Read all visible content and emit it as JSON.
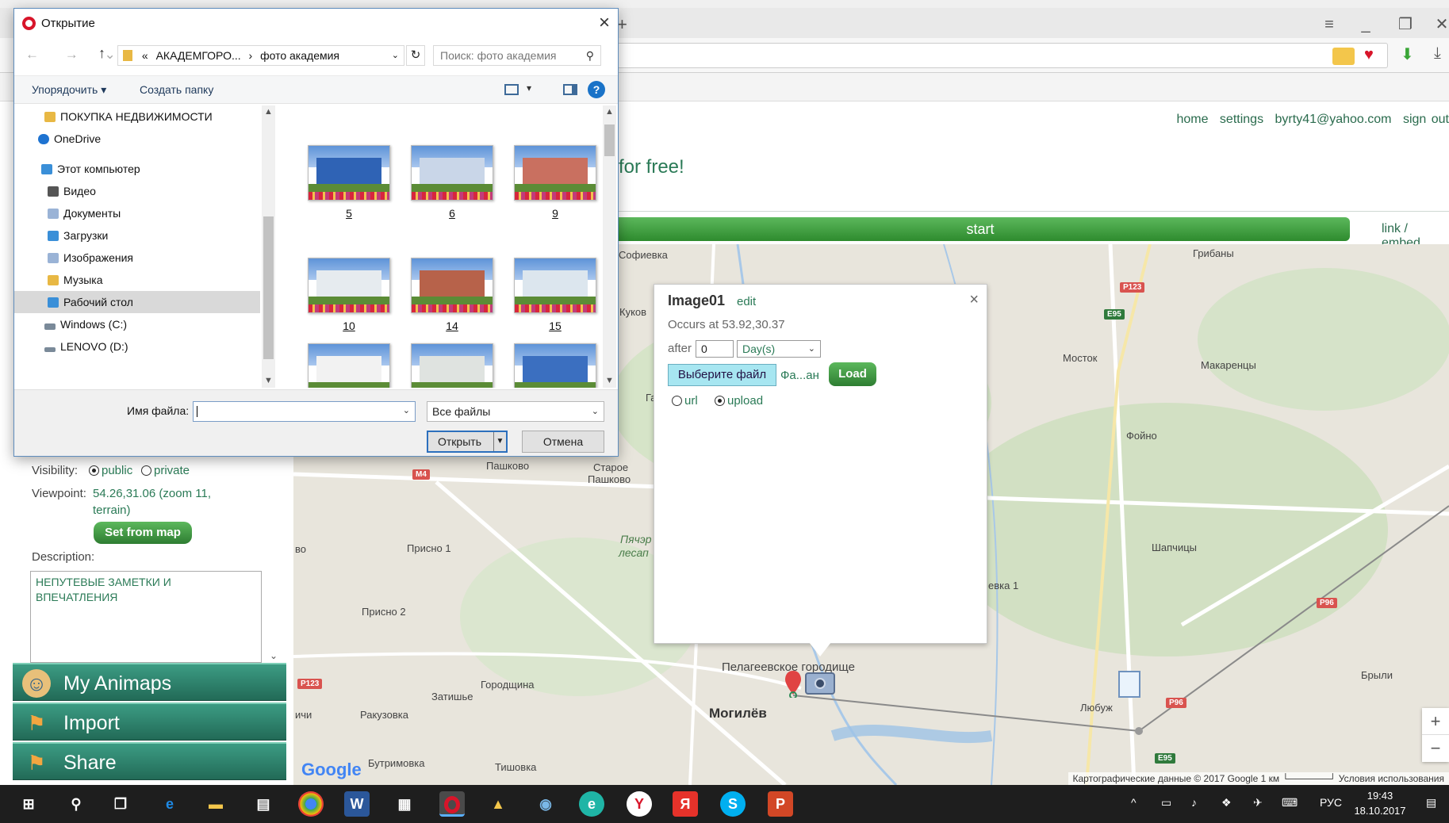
{
  "dialog": {
    "title": "Открытие",
    "path": {
      "prefix": "«",
      "segment1": "АКАДЕМГОРО...",
      "separator": "›",
      "segment2": "фото академия"
    },
    "search_placeholder": "Поиск: фото академия",
    "toolbar": {
      "organize": "Упорядочить ▾",
      "new_folder": "Создать папку",
      "help": "?"
    },
    "tree": [
      {
        "label": "ПОКУПКА НЕДВИЖИМОСТИ",
        "icon": "folder-icon",
        "color": "#e8b844"
      },
      {
        "label": "OneDrive",
        "icon": "onedrive-icon",
        "color": "#1e73d1"
      },
      {
        "label": "Этот компьютер",
        "icon": "computer-icon",
        "color": "#3a8fd8"
      },
      {
        "label": "Видео",
        "icon": "video-folder-icon",
        "color": "#555555"
      },
      {
        "label": "Документы",
        "icon": "documents-folder-icon",
        "color": "#9ab3d6"
      },
      {
        "label": "Загрузки",
        "icon": "downloads-folder-icon",
        "color": "#3a8fd8"
      },
      {
        "label": "Изображения",
        "icon": "pictures-folder-icon",
        "color": "#9ab3d6"
      },
      {
        "label": "Музыка",
        "icon": "music-folder-icon",
        "color": "#e8b844"
      },
      {
        "label": "Рабочий стол",
        "icon": "desktop-folder-icon",
        "color": "#3a8fd8"
      },
      {
        "label": "Windows (C:)",
        "icon": "drive-c-icon",
        "color": "#7a8a99"
      },
      {
        "label": "LENOVO (D:)",
        "icon": "drive-d-icon",
        "color": "#7a8a99"
      }
    ],
    "files": [
      {
        "label": "5",
        "bld": "#2f63b5"
      },
      {
        "label": "6",
        "bld": "#c9d6e8"
      },
      {
        "label": "9",
        "bld": "#c97060"
      },
      {
        "label": "10",
        "bld": "#e6ebef"
      },
      {
        "label": "14",
        "bld": "#b7624a"
      },
      {
        "label": "15",
        "bld": "#dce6ee"
      },
      {
        "label": "",
        "bld": "#f2f2f2"
      },
      {
        "label": "",
        "bld": "#dfe3e0"
      },
      {
        "label": "",
        "bld": "#3b6fc0"
      }
    ],
    "filename_label": "Имя файла:",
    "filename_value": "",
    "filetype": "Все файлы",
    "open_button": "Открыть",
    "cancel_button": "Отмена"
  },
  "page": {
    "links": [
      "home",
      "settings",
      "byrty41@yahoo.com",
      "sign out"
    ],
    "tagline": "for free!",
    "start": "start",
    "link_embed": "link / embed"
  },
  "popup": {
    "title": "Image01",
    "edit": "edit",
    "close": "×",
    "occurs": "Occurs at 53.92,30.37",
    "after_label": "after",
    "after_value": "0",
    "unit": "Day(s)",
    "choose_file": "Выберите файл",
    "file_name": "Фа...ан",
    "load": "Load",
    "radio_url": "url",
    "radio_upload": "upload"
  },
  "panel": {
    "visibility_label": "Visibility:",
    "public": "public",
    "private": "private",
    "viewpoint_label": "Viewpoint:",
    "viewpoint_line1": "54.26,31.06 (zoom 11,",
    "viewpoint_line2": "terrain)",
    "set_from_map": "Set from map",
    "description_label": "Description:",
    "description_line1": "НЕПУТЕВЫЕ ЗАМЕТКИ И",
    "description_line2": "ВПЕЧАТЛЕНИЯ"
  },
  "sidebar": [
    {
      "label": "My Animaps"
    },
    {
      "label": "Import"
    },
    {
      "label": "Share"
    }
  ],
  "map": {
    "labels": {
      "sofievka": "Софиевка",
      "gribany": "Грибаны",
      "kukov": "Куков",
      "mostok": "Мосток",
      "makarency": "Макаренцы",
      "foyno": "Фойно",
      "pashkovo": "Пашково",
      "staroe_pashkovo_1": "Старое",
      "staroe_pashkovo_2": "Пашково",
      "prisno1": "Присно 1",
      "prisno2": "Присно 2",
      "shapchicy": "Шапчицы",
      "evka1": "евка 1",
      "pelageevskoe": "Пелагеевское городище",
      "mogilev": "Могилёв",
      "zatishye": "Затишье",
      "gorodshchina": "Городщина",
      "rakuzovka": "Ракузовка",
      "lyubuzh": "Любуж",
      "brili": "Брыли",
      "butrimovka": "Бутримовка",
      "tishovka": "Тишовка",
      "ichi": "ичи",
      "vo": "во",
      "pyatr_1": "Пячэр",
      "pyatr_2": "лесап",
      "ga": "Га"
    },
    "signs": {
      "p123a": "P123",
      "e95a": "E95",
      "m4": "M4",
      "p123b": "P123",
      "p96a": "P96",
      "p96b": "P96",
      "e95b": "E95"
    },
    "google": "Google",
    "attribution": "Картографические данные © 2017 Google   1 км └──────┘   Условия использования",
    "zoom_in": "+",
    "zoom_out": "−"
  },
  "taskbar": {
    "lang": "РУС",
    "time": "19:43",
    "date": "18.10.2017"
  }
}
